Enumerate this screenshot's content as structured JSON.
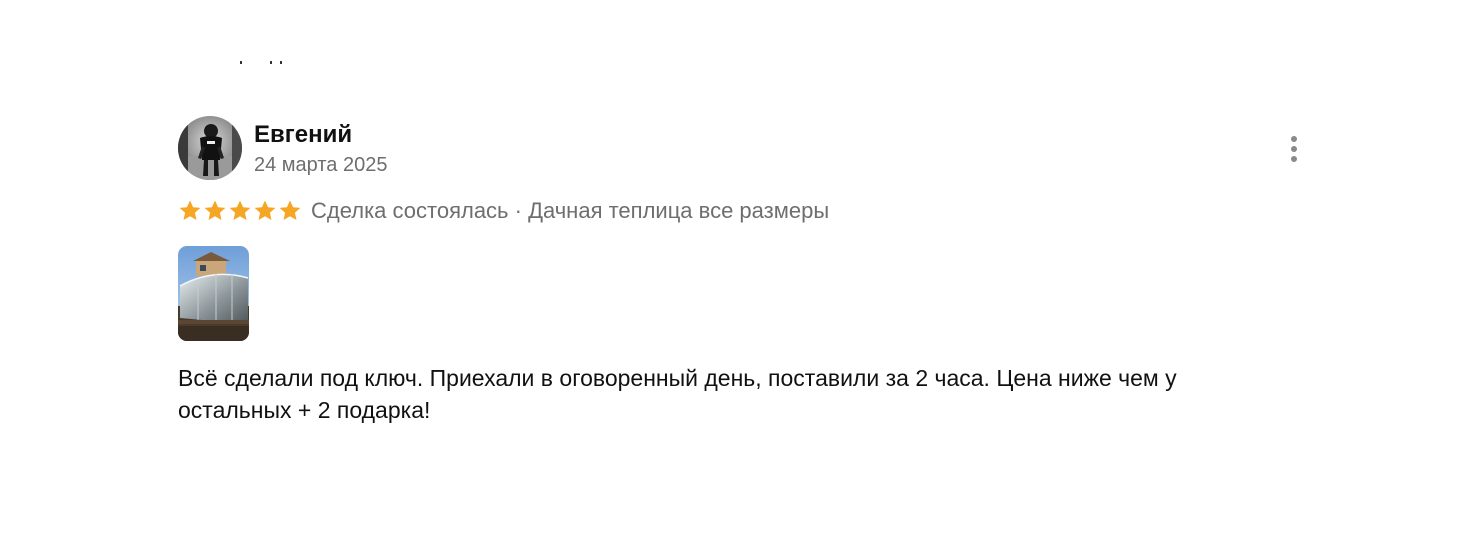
{
  "review": {
    "author_name": "Евгений",
    "date": "24 марта 2025",
    "rating": 5,
    "rating_max": 5,
    "meta": "Сделка состоялась · Дачная теплица все размеры",
    "text": "Всё сделали под ключ. Приехали в оговоренный день, поставили за 2 часа. Цена ниже чем у остальных + 2 подарка!",
    "star_color": "#f5a623",
    "icons": {
      "avatar": "user-avatar-photo",
      "more": "more-vertical-icon",
      "star": "star-icon",
      "photo": "greenhouse-photo"
    }
  }
}
